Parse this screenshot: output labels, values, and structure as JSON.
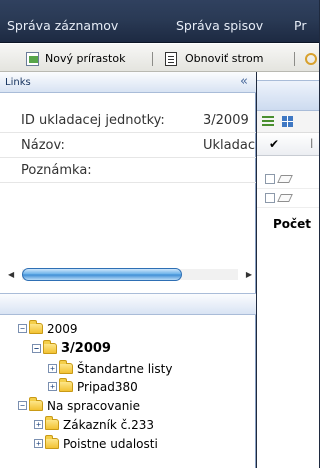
{
  "menu": {
    "items": [
      {
        "label": "Správa záznamov"
      },
      {
        "label": "Správa spisov"
      },
      {
        "label": "Pr"
      }
    ]
  },
  "toolbar": {
    "new_label": "Nový prírastok",
    "refresh_label": "Obnoviť strom"
  },
  "links_panel": {
    "title": "Links",
    "collapse_glyph": "«",
    "properties": [
      {
        "label": "ID ukladacej jednotky:",
        "value": "3/2009"
      },
      {
        "label": "Názov:",
        "value": "Ukladacia"
      },
      {
        "label": "Poznámka:",
        "value": ""
      }
    ]
  },
  "tree": {
    "nodes": [
      {
        "label": "2009",
        "toggle": "−"
      },
      {
        "label": "3/2009",
        "toggle": "−"
      },
      {
        "label": "Štandartne listy",
        "toggle": "+"
      },
      {
        "label": "Pripad380",
        "toggle": "+"
      },
      {
        "label": "Na spracovanie",
        "toggle": "−"
      },
      {
        "label": "Zákazník č.233",
        "toggle": "+"
      },
      {
        "label": "Poistne udalosti",
        "toggle": "+"
      }
    ]
  },
  "grid": {
    "check_glyph": "✔",
    "count_label": "Počet"
  },
  "colors": {
    "menubar": "#2a3a55",
    "panel_header": "#d8e3f3",
    "scroll_thumb": "#3a8ad3"
  },
  "icons": [
    "new-record-icon",
    "refresh-tree-icon",
    "search-icon",
    "list-view-icon",
    "grid-view-icon",
    "folder-icon"
  ]
}
